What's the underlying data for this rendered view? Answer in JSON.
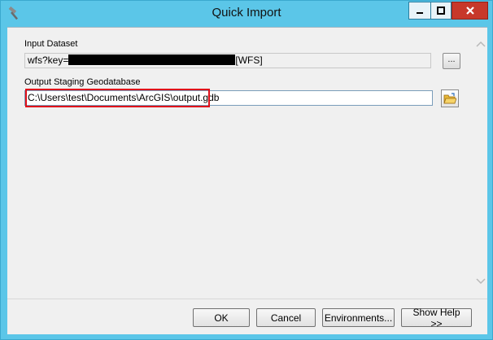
{
  "window": {
    "title": "Quick Import",
    "controls": {
      "minimize": "minimize",
      "maximize": "maximize",
      "close": "close"
    }
  },
  "form": {
    "input_dataset": {
      "label": "Input Dataset",
      "value_prefix": "wfs?key=",
      "value_suffix": "[WFS]",
      "browse_label": "..."
    },
    "output_gdb": {
      "label": "Output Staging Geodatabase",
      "value": "C:\\Users\\test\\Documents\\ArcGIS\\output.gdb"
    }
  },
  "buttons": {
    "ok": "OK",
    "cancel": "Cancel",
    "environments": "Environments...",
    "show_help": "Show Help >>"
  },
  "icons": {
    "app": "hammer-icon",
    "folder": "open-folder-icon",
    "scroll_up": "chevron-up-icon",
    "scroll_down": "chevron-down-icon"
  },
  "colors": {
    "titlebar": "#5bc6e8",
    "close_button": "#c7382a",
    "highlight": "#e0101a",
    "redaction": "#000000"
  }
}
